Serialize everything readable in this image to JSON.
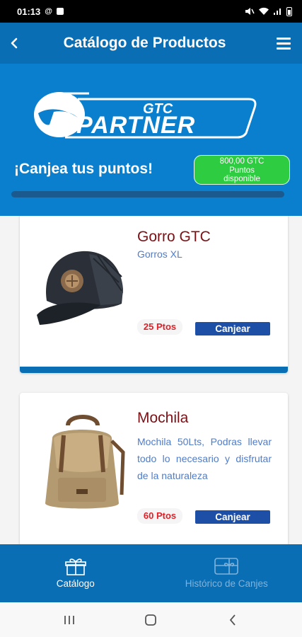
{
  "status_bar": {
    "time": "01:13"
  },
  "app_bar": {
    "title": "Catálogo de Productos"
  },
  "banner": {
    "logo_text": "GTC PARTNER",
    "redeem_title": "¡Canjea tus puntos!",
    "points_line1": "800,00 GTC",
    "points_line2": "Puntos",
    "points_line3": "disponible"
  },
  "products": [
    {
      "name": "Gorro GTC",
      "description": "Gorros XL",
      "points": "25 Ptos",
      "button": "Canjear",
      "image": "cap-image"
    },
    {
      "name": "Mochila",
      "description": "Mochila 50Lts, Podras llevar todo lo necesario y disfrutar de la naturaleza",
      "points": "60 Ptos",
      "button": "Canjear",
      "image": "backpack-image"
    }
  ],
  "bottom_nav": [
    {
      "label": "Catálogo",
      "icon": "gift-icon",
      "active": true
    },
    {
      "label": "Histórico de Canjes",
      "icon": "gift-card-icon",
      "active": false
    }
  ],
  "colors": {
    "primary": "#0a6eb5",
    "banner": "#0a7fce",
    "points_badge": "#2ecc40",
    "product_name": "#7b1015",
    "description": "#4f7cc9",
    "points": "#e01f26",
    "button": "#1d4fa6"
  }
}
